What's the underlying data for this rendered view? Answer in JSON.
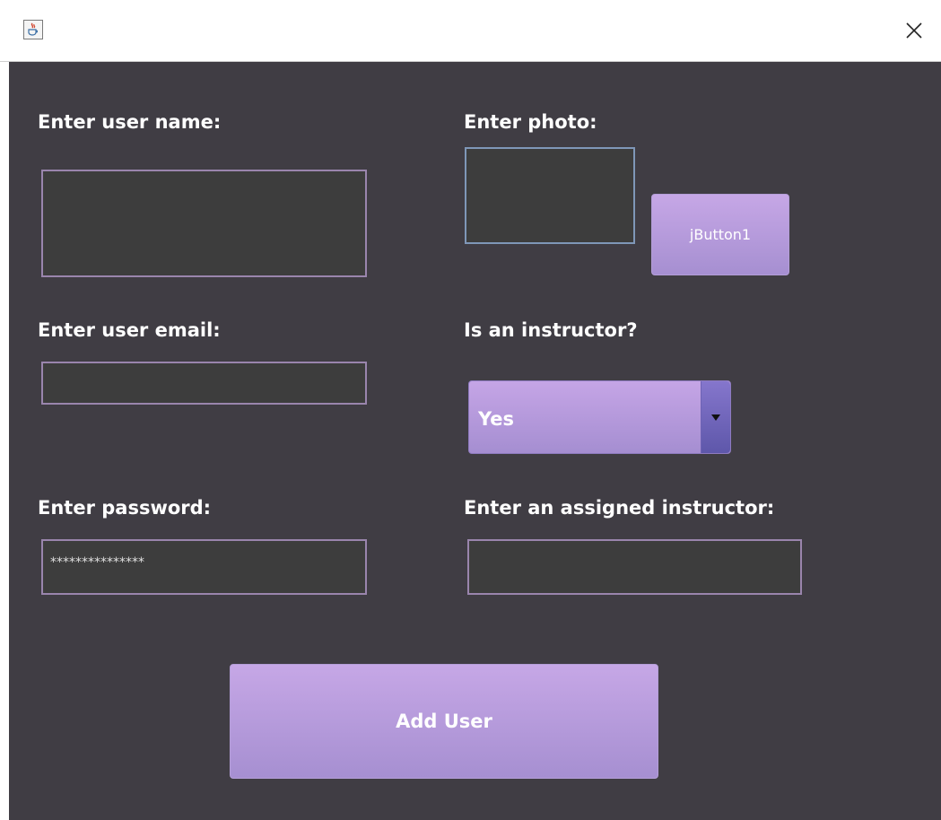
{
  "window": {
    "icon": "java-icon",
    "close_icon": "close-icon"
  },
  "form": {
    "user_name": {
      "label": "Enter user name:",
      "value": ""
    },
    "photo": {
      "label": "Enter photo:",
      "value": "",
      "button_label": "jButton1"
    },
    "user_email": {
      "label": "Enter user email:",
      "value": ""
    },
    "instructor": {
      "label": "Is an instructor?",
      "selected": "Yes"
    },
    "password": {
      "label": "Enter password:",
      "value": "***************"
    },
    "assigned_instructor": {
      "label": "Enter an assigned instructor:",
      "value": ""
    },
    "submit_label": "Add User"
  },
  "colors": {
    "background": "#403d44",
    "accent": "#b39ddb",
    "field": "#3d3d3d",
    "field_border": "#9a85ad"
  }
}
